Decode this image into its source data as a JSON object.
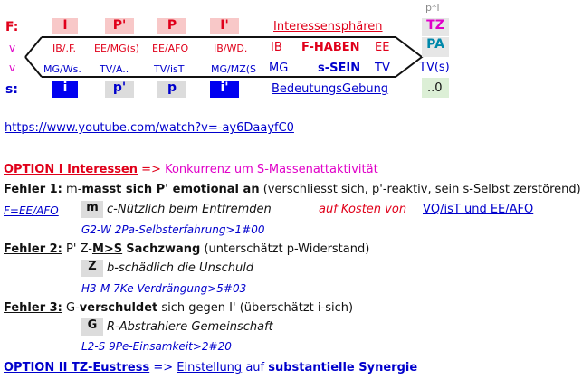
{
  "top": {
    "row_f": {
      "label": "F:",
      "c1": "I",
      "c2": "P'",
      "c3": "P",
      "c4": "I'",
      "link": "Interessensphären"
    },
    "pstar": "p*i",
    "tz": "TZ",
    "pa": "PA",
    "tvs": "TV(s)",
    "row_v1": {
      "label": "v",
      "c1": "IB/.F.",
      "c2": "EE/MG(s)",
      "c3": "EE/AFO",
      "c4": "IB/WD.",
      "c5": "IB",
      "c6": "F-HABEN",
      "c7": "EE"
    },
    "row_v2": {
      "label": "v",
      "c1": "MG/Ws.",
      "c2": "TV/A..",
      "c3": "TV/isT",
      "c4": "MG/MZ(S",
      "c5": "MG",
      "c6": "s-SEIN",
      "c7": "TV"
    },
    "row_s": {
      "label": "s:",
      "c1": "i",
      "c2": "p'",
      "c3": "p",
      "c4": "i'",
      "link": "BedeutungsGebung",
      "end": "..0"
    }
  },
  "url": "https://www.youtube.com/watch?v=-ay6DaayfC0",
  "option1": {
    "title": "OPTION I Interessen",
    "arrow": "=>",
    "rest": "Konkurrenz um S-Massenattaktivität"
  },
  "f1": {
    "label": "Fehler 1:",
    "pre": "m-",
    "bold": "masst sich P' emotional an",
    "rest": "(verschliesst sich, p'-reaktiv, sein s-Selbst zerstörend)",
    "code": "F=EE/AFO",
    "box": "m",
    "desc": "c-Nützlich beim Entfremden",
    "cost": "auf Kosten von",
    "cost_link": "VQ/isT und EE/AFO",
    "ref": "G2-W 2Pa-Selbsterfahrung>1#00"
  },
  "f2": {
    "label": "Fehler 2:",
    "pre": "P' Z-",
    "bold1": "M>S",
    "bold2": "Sachzwang",
    "rest": "(unterschätzt p-Widerstand)",
    "box": "Z",
    "desc": "b-schädlich die Unschuld",
    "ref": "H3-M 7Ke-Verdrängung>5#03"
  },
  "f3": {
    "label": "Fehler 3:",
    "pre": "G-",
    "bold": "verschuldet",
    "rest": "sich gegen I'  (überschätzt i-sich)",
    "box": "G",
    "desc": "R-Abstrahiere Gemeinschaft",
    "ref": "L2-S 9Pe-Einsamkeit>2#20"
  },
  "option2": {
    "title": "OPTION II TZ-Eustress",
    "arrow": "=>",
    "link": "Einstellung",
    "mid": "auf",
    "bold": "substantielle Synergie"
  }
}
